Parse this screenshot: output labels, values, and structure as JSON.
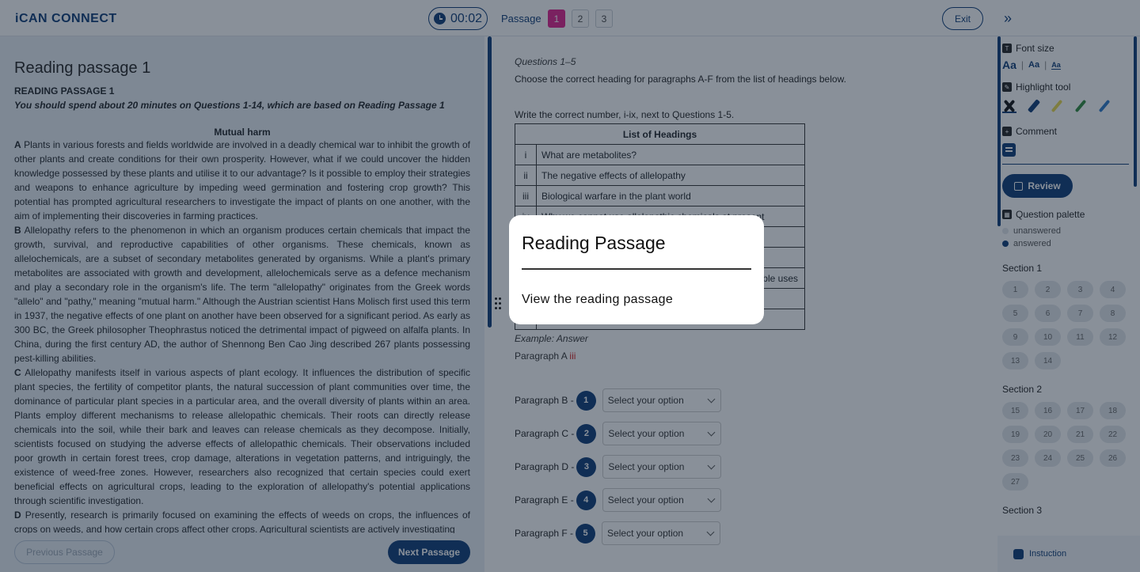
{
  "header": {
    "logo_text": "iCAN CONNECT",
    "timer": "00:02",
    "passage_label": "Passage",
    "passages": [
      "1",
      "2",
      "3"
    ],
    "exit_label": "Exit",
    "expand_icon": "double-chevron-right-icon"
  },
  "passage": {
    "page_title": "Reading passage 1",
    "heading": "READING PASSAGE 1",
    "instruction": "You should spend about 20 minutes on Questions 1-14, which are based on Reading Passage 1",
    "title": "Mutual harm",
    "paragraphs": [
      {
        "letter": "A",
        "text": "Plants in various forests and fields worldwide are involved in a deadly chemical war to inhibit the growth of other plants and create conditions for their own prosperity. However, what if we could uncover the hidden knowledge possessed by these plants and utilise it to our advantage? Is it possible to employ their strategies and weapons to enhance agriculture by impeding weed germination and fostering crop growth? This potential has prompted agricultural researchers to investigate the impact of plants on one another, with the aim of implementing their discoveries in farming practices."
      },
      {
        "letter": "B",
        "text": "Allelopathy refers to the phenomenon in which an organism produces certain chemicals that impact the growth, survival, and reproductive capabilities of other organisms. These chemicals, known as allelochemicals, are a subset of secondary metabolites generated by organisms. While a plant's primary metabolites are associated with growth and development, allelochemicals serve as a defence mechanism and play a secondary role in the organism's life. The term \"allelopathy\" originates from the Greek words \"allelo\" and \"pathy,\" meaning \"mutual harm.\" Although the Austrian scientist Hans Molisch first used this term in 1937, the negative effects of one plant on another have been observed for a significant period. As early as 300 BC, the Greek philosopher Theophrastus noticed the detrimental impact of pigweed on alfalfa plants. In China, during the first century AD, the author of Shennong Ben Cao Jing described 267 plants possessing pest-killing abilities."
      },
      {
        "letter": "C",
        "text": "Allelopathy manifests itself in various aspects of plant ecology. It influences the distribution of specific plant species, the fertility of competitor plants, the natural succession of plant communities over time, the dominance of particular plant species in a particular area, and the overall diversity of plants within an area. Plants employ different mechanisms to release allelopathic chemicals. Their roots can directly release chemicals into the soil, while their bark and leaves can release chemicals as they decompose. Initially, scientists focused on studying the adverse effects of allelopathic chemicals. Their observations included poor growth in certain forest trees, crop damage, alterations in vegetation patterns, and intriguingly, the existence of weed-free zones. However, researchers also recognized that certain species could exert beneficial effects on agricultural crops, leading to the exploration of allelopathy's potential applications through scientific investigation."
      },
      {
        "letter": "D",
        "text": "Presently, research is primarily focused on examining the effects of weeds on crops, the influences of crops on weeds, and how certain crops affect other crops. Agricultural scientists are actively investigating"
      }
    ],
    "prev_label": "Previous Passage",
    "next_label": "Next Passage"
  },
  "questions": {
    "range": "Questions 1–5",
    "instruction": "Choose the correct heading for paragraphs A-F from the list of headings below.",
    "instruction2": "Write the correct number, i-ix, next to Questions 1-5.",
    "table_header": "List of Headings",
    "headings": [
      {
        "num": "i",
        "text": "What are metabolites?"
      },
      {
        "num": "ii",
        "text": "The negative effects of allelopathy"
      },
      {
        "num": "iii",
        "text": "Biological warfare in the plant world"
      },
      {
        "num": "iv",
        "text": "Why we cannot use allelopathic chemicals at present"
      },
      {
        "num": "",
        "text": ""
      },
      {
        "num": "",
        "text": ""
      },
      {
        "num": "",
        "text": "ble uses"
      },
      {
        "num": "",
        "text": ""
      },
      {
        "num": "",
        "text": ""
      }
    ],
    "example_label": "Example: Answer",
    "example_para": "Paragraph A",
    "example_answer": "iii",
    "items": [
      {
        "label": "Paragraph B -",
        "num": "1",
        "placeholder": "Select your option"
      },
      {
        "label": "Paragraph C -",
        "num": "2",
        "placeholder": "Select your option"
      },
      {
        "label": "Paragraph D -",
        "num": "3",
        "placeholder": "Select your option"
      },
      {
        "label": "Paragraph E -",
        "num": "4",
        "placeholder": "Select your option"
      },
      {
        "label": "Paragraph F -",
        "num": "5",
        "placeholder": "Select your option"
      }
    ]
  },
  "sidebar": {
    "font_size_label": "Font size",
    "font_sizes": [
      "Aa",
      "Aa",
      "Aa"
    ],
    "highlight_label": "Highlight tool",
    "highlight_colors": [
      "#111111",
      "#0d3b77",
      "#e8d84a",
      "#2e8b3d",
      "#2a78c8"
    ],
    "comment_label": "Comment",
    "review_label": "Review",
    "palette_label": "Question palette",
    "legend_unanswered": "unanswered",
    "legend_answered": "answered",
    "sections": [
      {
        "label": "Section 1",
        "questions": [
          "1",
          "2",
          "3",
          "4",
          "5",
          "6",
          "7",
          "8",
          "9",
          "10",
          "11",
          "12",
          "13",
          "14"
        ]
      },
      {
        "label": "Section 2",
        "questions": [
          "15",
          "16",
          "17",
          "18",
          "19",
          "20",
          "21",
          "22",
          "23",
          "24",
          "25",
          "26",
          "27"
        ]
      },
      {
        "label": "Section 3",
        "questions": []
      }
    ],
    "instruction_label": "Instuction"
  },
  "modal": {
    "title": "Reading Passage",
    "link": "View the reading passage"
  },
  "colors": {
    "brand": "#0d3b77",
    "accent": "#e1208d",
    "answer_red": "#d62020"
  }
}
